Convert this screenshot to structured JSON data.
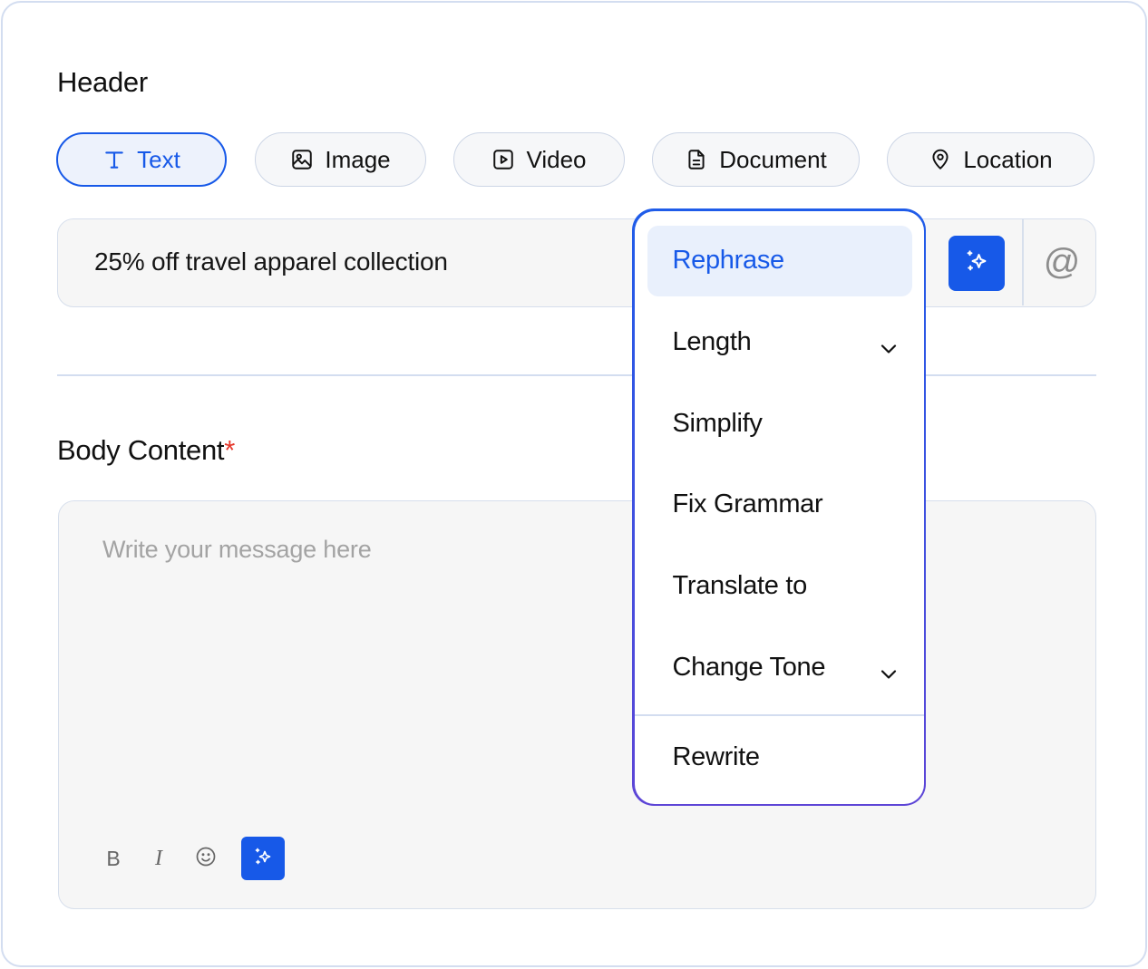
{
  "header": {
    "title": "Header",
    "tabs": [
      {
        "label": "Text",
        "icon": "text-icon",
        "active": true
      },
      {
        "label": "Image",
        "icon": "image-icon",
        "active": false
      },
      {
        "label": "Video",
        "icon": "video-icon",
        "active": false
      },
      {
        "label": "Document",
        "icon": "document-icon",
        "active": false
      },
      {
        "label": "Location",
        "icon": "location-icon",
        "active": false
      }
    ],
    "input_value": "25% off travel apparel collection",
    "ai_icon": "ai-sparkle-icon",
    "mention_symbol": "@"
  },
  "body": {
    "title": "Body Content",
    "required_mark": "*",
    "placeholder": "Write your message here",
    "toolbar": {
      "bold": "B",
      "italic": "I",
      "emoji_icon": "emoji-icon",
      "ai_icon": "ai-sparkle-icon"
    }
  },
  "ai_menu": {
    "items": [
      {
        "label": "Rephrase",
        "selected": true,
        "has_submenu": false
      },
      {
        "label": "Length",
        "selected": false,
        "has_submenu": true
      },
      {
        "label": "Simplify",
        "selected": false,
        "has_submenu": false
      },
      {
        "label": "Fix Grammar",
        "selected": false,
        "has_submenu": false
      },
      {
        "label": "Translate to",
        "selected": false,
        "has_submenu": false
      },
      {
        "label": "Change Tone",
        "selected": false,
        "has_submenu": true
      }
    ],
    "footer_item": "Rewrite"
  },
  "colors": {
    "accent": "#1759e8",
    "required": "#e5372b",
    "menu_gradient_start": "#1f5ce9",
    "menu_gradient_end": "#5d45d6"
  }
}
